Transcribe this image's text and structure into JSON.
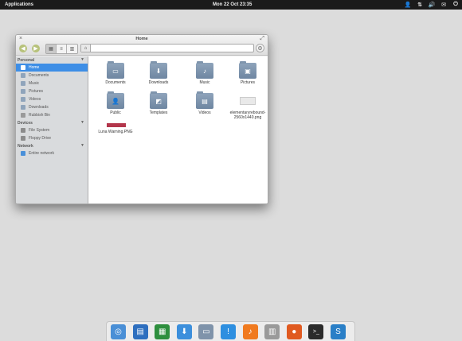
{
  "panel": {
    "applications": "Applications",
    "clock": "Mon 22 Oct 23:35",
    "indicators": [
      {
        "name": "user-icon",
        "glyph": "👤"
      },
      {
        "name": "network-icon",
        "glyph": "⇅"
      },
      {
        "name": "volume-icon",
        "glyph": "🔊"
      },
      {
        "name": "mail-icon",
        "glyph": "✉"
      },
      {
        "name": "power-icon",
        "glyph": "⏻"
      }
    ]
  },
  "window": {
    "title": "Home",
    "close_glyph": "×",
    "maximize_glyph": "⤢"
  },
  "toolbar": {
    "back_glyph": "◀",
    "forward_glyph": "▶",
    "views": [
      {
        "name": "icon-view-button",
        "glyph": "▦",
        "active": true
      },
      {
        "name": "list-view-button",
        "glyph": "≡",
        "active": false
      },
      {
        "name": "column-view-button",
        "glyph": "▥",
        "active": false
      }
    ],
    "home_glyph": "⌂",
    "gear_glyph": "⚙"
  },
  "sidebar": {
    "sections": [
      {
        "title": "Personal",
        "items": [
          {
            "label": "Home",
            "color": "#5b7fae",
            "selected": true
          },
          {
            "label": "Documents",
            "color": "#8fa4bb"
          },
          {
            "label": "Music",
            "color": "#8fa4bb"
          },
          {
            "label": "Pictures",
            "color": "#8fa4bb"
          },
          {
            "label": "Videos",
            "color": "#8fa4bb"
          },
          {
            "label": "Downloads",
            "color": "#8fa4bb"
          },
          {
            "label": "Rubbish Bin",
            "color": "#9a9a9a"
          }
        ]
      },
      {
        "title": "Devices",
        "items": [
          {
            "label": "File System",
            "color": "#8c8c8c"
          },
          {
            "label": "Floppy Drive",
            "color": "#8c8c8c"
          }
        ]
      },
      {
        "title": "Network",
        "items": [
          {
            "label": "Entire network",
            "color": "#4a90d9"
          }
        ]
      }
    ]
  },
  "files": [
    {
      "name": "Documents",
      "kind": "folder",
      "emblem": "▭"
    },
    {
      "name": "Downloads",
      "kind": "folder",
      "emblem": "⬇"
    },
    {
      "name": "Music",
      "kind": "folder",
      "emblem": "♪"
    },
    {
      "name": "Pictures",
      "kind": "folder",
      "emblem": "▣"
    },
    {
      "name": "Public",
      "kind": "folder",
      "emblem": "👤"
    },
    {
      "name": "Templates",
      "kind": "folder",
      "emblem": "◩"
    },
    {
      "name": "Videos",
      "kind": "folder",
      "emblem": "▤"
    },
    {
      "name": "elementaryrebound-2560x1440.png",
      "kind": "image",
      "emblem": ""
    },
    {
      "name": "Luna Warning.PNG",
      "kind": "png",
      "emblem": ""
    }
  ],
  "dock": [
    {
      "name": "chromium-icon",
      "color": "#4a8fd6",
      "glyph": "◎"
    },
    {
      "name": "writer-icon",
      "color": "#2e6fbf",
      "glyph": "▤"
    },
    {
      "name": "calc-icon",
      "color": "#2e8f3e",
      "glyph": "▦"
    },
    {
      "name": "downloader-icon",
      "color": "#3c8fdc",
      "glyph": "⬇"
    },
    {
      "name": "files-icon",
      "color": "#7f93aa",
      "glyph": "▭"
    },
    {
      "name": "messaging-icon",
      "color": "#2e8fe0",
      "glyph": "!"
    },
    {
      "name": "music-player-icon",
      "color": "#f07a1f",
      "glyph": "♪"
    },
    {
      "name": "switchboard-icon",
      "color": "#9a9a9a",
      "glyph": "▥"
    },
    {
      "name": "photos-icon",
      "color": "#e05a20",
      "glyph": "●"
    },
    {
      "name": "terminal-icon",
      "color": "#2b2b2b",
      "glyph": ">_"
    },
    {
      "name": "software-center-icon",
      "color": "#2a7fc7",
      "glyph": "S"
    }
  ]
}
